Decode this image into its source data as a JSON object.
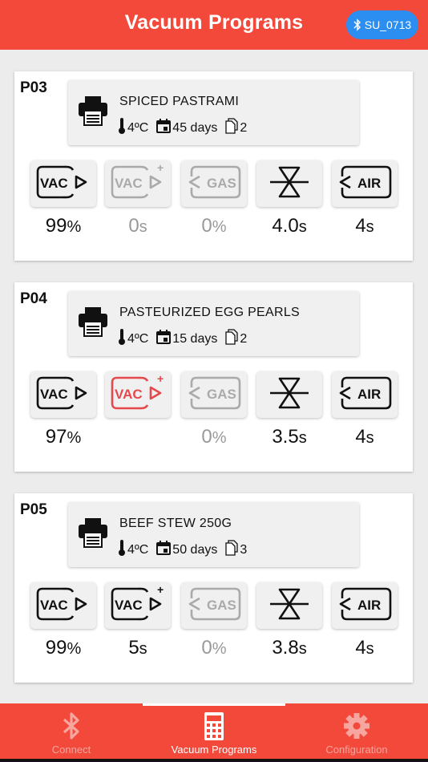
{
  "header": {
    "title": "Vacuum Programs",
    "device": "SU_0713"
  },
  "buttons": {
    "vac": "VAC",
    "vacplus": "VAC",
    "gas": "GAS",
    "air": "AIR"
  },
  "programs": [
    {
      "id": "P03",
      "name": "SPICED PASTRAMI",
      "temp": "4ºC",
      "days": "45 days",
      "copies": "2",
      "vac": "99",
      "vac_plus": "0",
      "gas": "0",
      "seal": "4.0",
      "air": "4",
      "vac_plus_active": false,
      "vac_plus_error": false
    },
    {
      "id": "P04",
      "name": "PASTEURIZED EGG PEARLS",
      "temp": "4ºC",
      "days": "15 days",
      "copies": "2",
      "vac": "97",
      "vac_plus": "",
      "gas": "0",
      "seal": "3.5",
      "air": "4",
      "vac_plus_active": false,
      "vac_plus_error": true
    },
    {
      "id": "P05",
      "name": "BEEF STEW 250G",
      "temp": "4ºC",
      "days": "50 days",
      "copies": "3",
      "vac": "99",
      "vac_plus": "5",
      "gas": "0",
      "seal": "3.8",
      "air": "4",
      "vac_plus_active": true,
      "vac_plus_error": false
    }
  ],
  "units": {
    "percent": "%",
    "seconds": "s"
  },
  "nav": {
    "connect": "Connect",
    "programs": "Vacuum Programs",
    "config": "Configuration"
  },
  "colors": {
    "accent": "#f2493b",
    "bluetooth": "#2b8ef0",
    "error": "#e5484d"
  }
}
